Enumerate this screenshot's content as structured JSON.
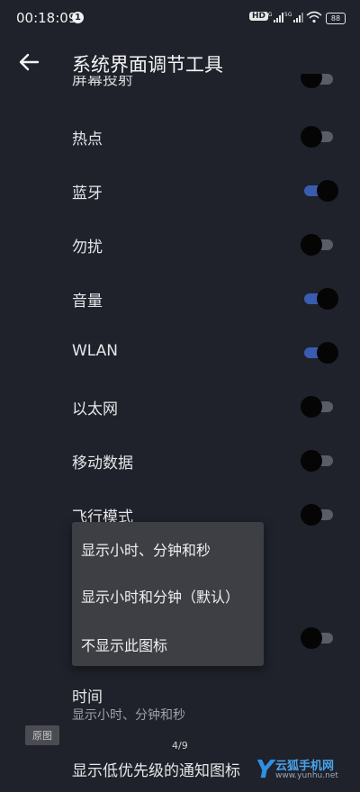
{
  "status_bar": {
    "time": "00:18:09",
    "notification": "1",
    "hd_label": "HD",
    "sig1": "5G",
    "sig2": "5G",
    "battery": "88"
  },
  "header": {
    "title": "系统界面调节工具"
  },
  "partial_label": "屏幕投射",
  "rows": [
    {
      "label": "热点",
      "on": false
    },
    {
      "label": "蓝牙",
      "on": true
    },
    {
      "label": "勿扰",
      "on": false
    },
    {
      "label": "音量",
      "on": true
    },
    {
      "label": "WLAN",
      "on": true
    },
    {
      "label": "以太网",
      "on": false
    },
    {
      "label": "移动数据",
      "on": false
    },
    {
      "label": "飞行模式",
      "on": false
    }
  ],
  "hidden_row_toggle_on": false,
  "popup": {
    "options": [
      "显示小时、分钟和秒",
      "显示小时和分钟（默认）",
      "不显示此图标"
    ]
  },
  "time_setting": {
    "title": "时间",
    "value": "显示小时、分钟和秒"
  },
  "original_badge": "原图",
  "pager": "4/9",
  "low_priority": "显示低优先级的通知图标",
  "watermark": {
    "brand": "云狐手机网",
    "url": "www.yunhu.net",
    "y": "Y"
  },
  "colors": {
    "background": "#1f222b",
    "toggle_on": "#3a5cb0",
    "popup_bg": "#3d3f44"
  }
}
